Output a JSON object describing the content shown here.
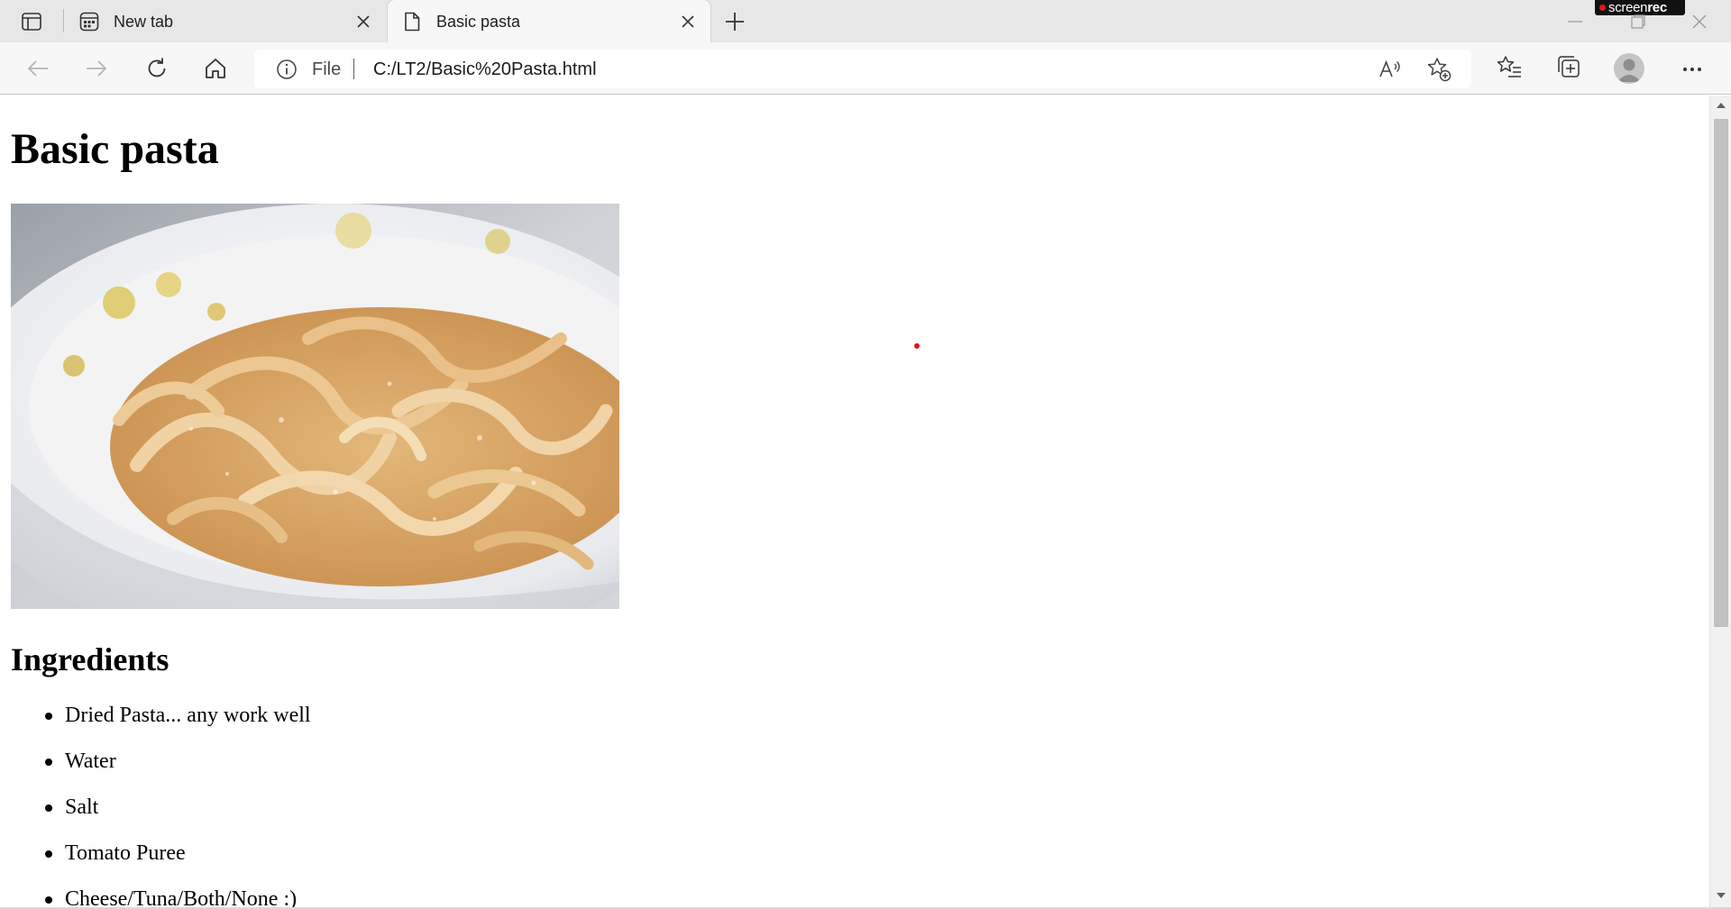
{
  "browser": {
    "tabs": [
      {
        "title": "New tab",
        "icon": "new-tab-page-icon",
        "active": false
      },
      {
        "title": "Basic pasta",
        "icon": "document-icon",
        "active": true
      }
    ],
    "address_bar": {
      "scheme_label": "File",
      "url": "C:/LT2/Basic%20Pasta.html"
    },
    "toolbar_icons": [
      "back-icon",
      "forward-icon",
      "refresh-icon",
      "home-icon",
      "read-aloud-icon",
      "add-favorite-icon",
      "favorites-icon",
      "collections-icon",
      "profile-icon",
      "more-icon"
    ],
    "recorder_badge": {
      "light": "screen",
      "bold": "rec",
      "dot_color": "#e0161f"
    }
  },
  "page": {
    "title": "Basic pasta",
    "image_description": "bowl-of-fresh-tagliatelle",
    "ingredients_heading": "Ingredients",
    "ingredients": [
      "Dried Pasta... any work well",
      "Water",
      "Salt",
      "Tomato Puree",
      "Cheese/Tuna/Both/None :)"
    ]
  },
  "colors": {
    "tabstrip": "#e7e7e7",
    "toolbar": "#f7f7f7",
    "cursor": "#e0161f",
    "scroll_thumb": "#c1c1c1"
  }
}
